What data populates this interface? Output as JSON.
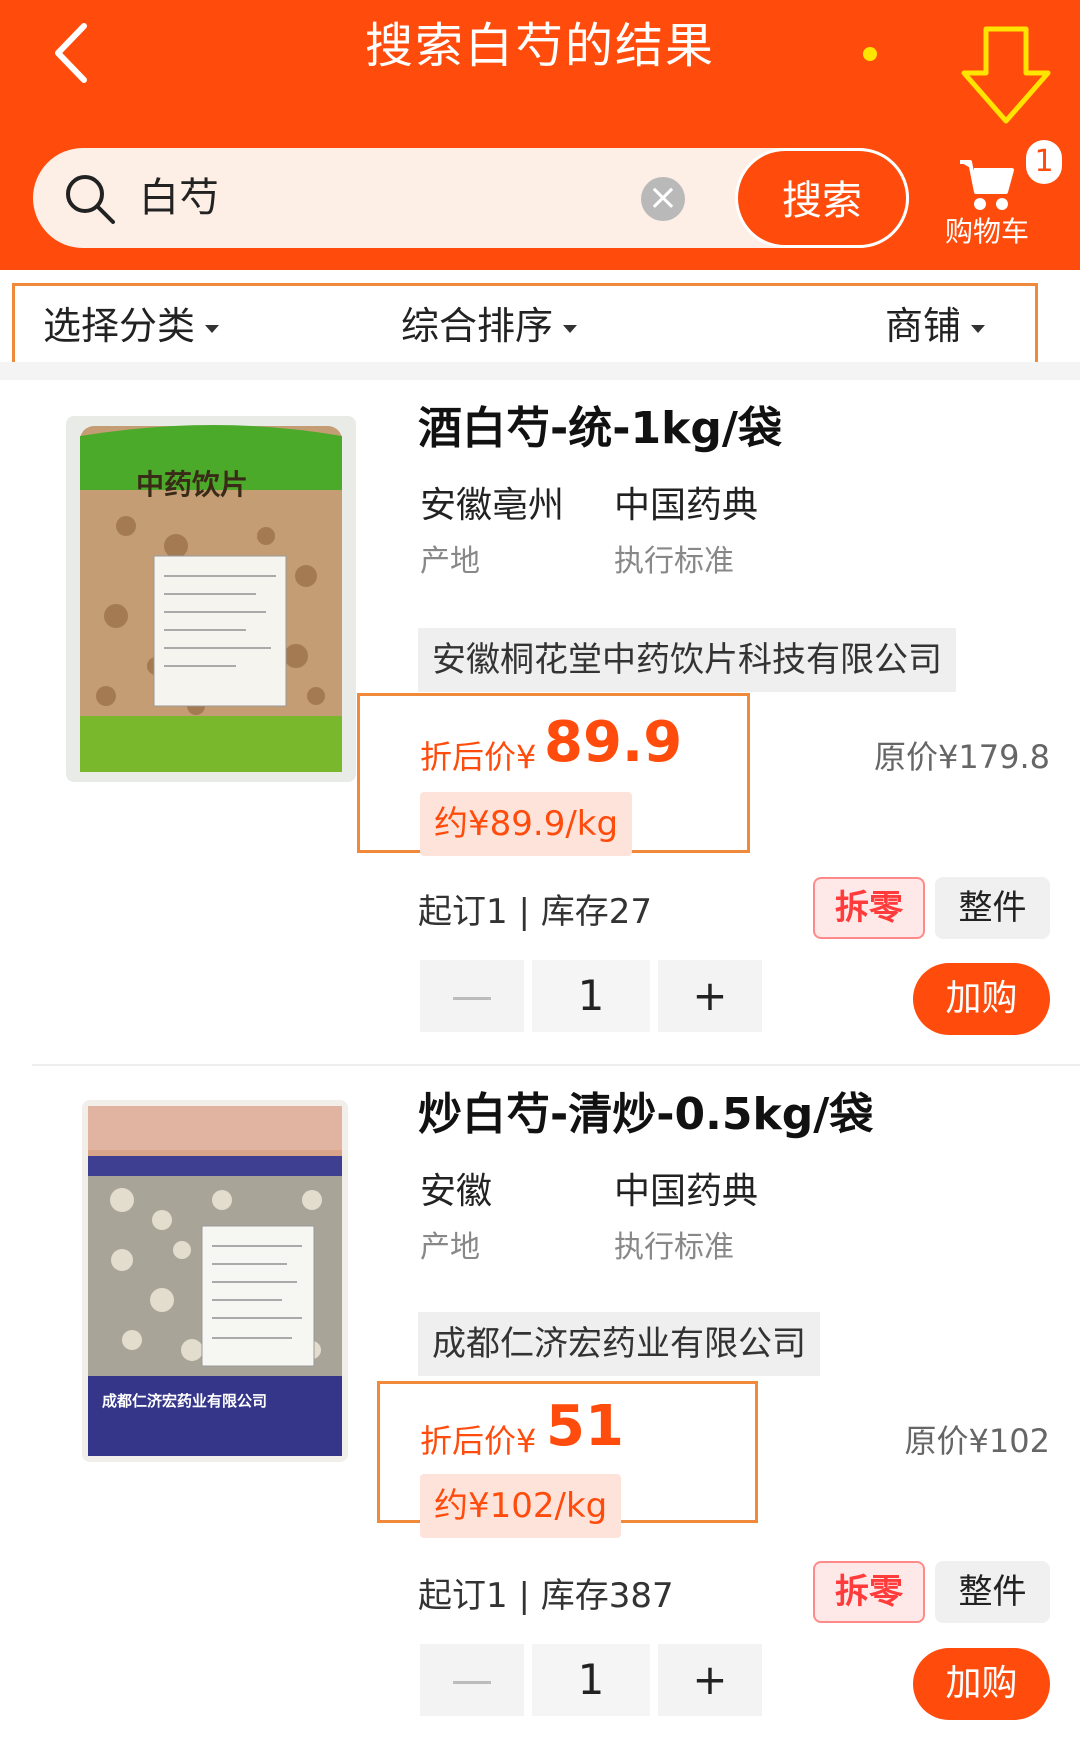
{
  "header": {
    "title": "搜索白芍的结果",
    "accent": "#ff4b0b"
  },
  "search": {
    "value": "白芍",
    "button": "搜索"
  },
  "cart": {
    "label": "购物车",
    "count": "1"
  },
  "filters": [
    "选择分类",
    "综合排序",
    "商铺"
  ],
  "products": [
    {
      "name": "酒白芍-统-1kg/袋",
      "origin": "安徽亳州",
      "origin_label": "产地",
      "standard": "中国药典",
      "standard_label": "执行标准",
      "shop": "安徽桐花堂中药饮片科技有限公司",
      "price_label": "折后价¥",
      "price": "89.9",
      "unit_price": "约¥89.9/kg",
      "original_price": "原价¥179.8",
      "stock": "起订1 | 库存27",
      "tag_split": "拆零",
      "tag_whole": "整件",
      "qty": "1",
      "minus": "—",
      "plus": "+",
      "add": "加购",
      "image_text": "中药饮片"
    },
    {
      "name": "炒白芍-清炒-0.5kg/袋",
      "origin": "安徽",
      "origin_label": "产地",
      "standard": "中国药典",
      "standard_label": "执行标准",
      "shop": "成都仁济宏药业有限公司",
      "price_label": "折后价¥",
      "price": "51",
      "unit_price": "约¥102/kg",
      "original_price": "原价¥102",
      "stock": "起订1 | 库存387",
      "tag_split": "拆零",
      "tag_whole": "整件",
      "qty": "1",
      "minus": "—",
      "plus": "+",
      "add": "加购",
      "image_text": "成都仁济宏药业有限公司"
    }
  ]
}
